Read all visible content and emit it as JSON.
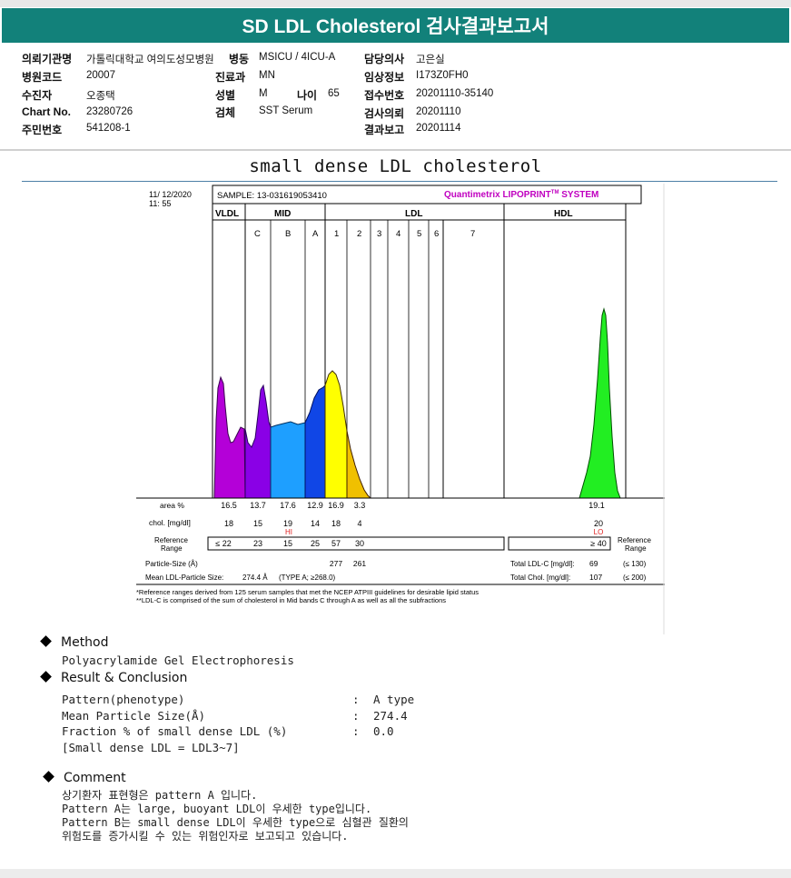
{
  "report": {
    "title": "SD LDL Cholesterol 검사결과보고서"
  },
  "info": {
    "hospital_label": "의뢰기관명",
    "hospital": "가톨릭대학교 여의도성모병원",
    "ward_label": "병동",
    "ward": "MSICU / 4ICU-A",
    "doctor_label": "담당의사",
    "doctor": "고은실",
    "code_label": "병원코드",
    "code": "20007",
    "dept_label": "진료과",
    "dept": "MN",
    "clinical_label": "임상정보",
    "clinical": "I173Z0FH0",
    "patient_label": "수진자",
    "patient": "오종택",
    "sex_label": "성별",
    "sex": "M",
    "age_label": "나이",
    "age": "65",
    "receipt_label": "접수번호",
    "receipt": "20201110-35140",
    "chart_label": "Chart No.",
    "chart": "23280726",
    "specimen_label": "검체",
    "specimen": "SST Serum",
    "request_label": "검사의뢰",
    "request": "20201110",
    "id_label": "주민번호",
    "id": "541208-1",
    "reported_label": "결과보고",
    "reported": "20201114"
  },
  "section_title": "small dense LDL cholesterol",
  "figure": {
    "date": "11/ 12/2020",
    "time": "11: 55",
    "sample": "SAMPLE:  13-031619053410",
    "brand": "Quantimetrix LIPOPRINT",
    "brand_tm": "TM",
    "brand_sys": " SYSTEM",
    "header_vldl": "VLDL",
    "header_mid": "MID",
    "header_ldl": "LDL",
    "header_hdl": "HDL",
    "bands": [
      "C",
      "B",
      "A",
      "1",
      "2",
      "3",
      "4",
      "5",
      "6",
      "7"
    ],
    "row_area_label": "area %",
    "row_chol_label": "chol. [mg/dl]",
    "row_ref_label1": "Reference",
    "row_ref_label2": "Range",
    "areas": [
      "16.5",
      "13.7",
      "17.6",
      "12.9",
      "16.9",
      "3.3",
      "19.1"
    ],
    "chols": [
      "18",
      "15",
      "19",
      "14",
      "18",
      "4",
      "20"
    ],
    "flag_hi": "HI",
    "flag_lo": "LO",
    "ref_left": [
      "≤ 22",
      "23",
      "15",
      "25",
      "57",
      "30"
    ],
    "ref_hdl": "≥ 40",
    "ref_right1": "Reference",
    "ref_right2": "Range",
    "particle_label": "Particle-Size (Å)",
    "particle_1": "277",
    "particle_2": "261",
    "mean_label": "Mean LDL-Particle Size:",
    "mean_value": "274.4 Å",
    "mean_type": "(TYPE A; ≥268.0)",
    "total_ldl_label": "Total LDL-C [mg/dl]:",
    "total_ldl": "69",
    "total_ldl_ref": "(≤ 130)",
    "total_chol_label": "Total Chol. [mg/dl]:",
    "total_chol": "107",
    "total_chol_ref": "(≤ 200)",
    "foot1": "*Reference ranges derived from 125 serum samples that met the NCEP ATPIII guidelines for desirable lipid status",
    "foot2": "**LDL-C is comprised of the sum of cholesterol in Mid bands C through A as well as all the subfractions",
    "colors": {
      "vldl": "#b400d8",
      "c": "#8a00e6",
      "b": "#1e9fff",
      "a": "#1046e6",
      "ldl1": "#ffff00",
      "ldl2": "#f0c000",
      "hdl": "#22ee22"
    }
  },
  "method": {
    "heading": "Method",
    "text": "Polyacrylamide Gel Electrophoresis"
  },
  "result": {
    "heading": "Result & Conclusion",
    "rows": [
      {
        "label": "Pattern(phenotype)",
        "colon": ":",
        "value": "A type"
      },
      {
        "label": "Mean Particle Size(Å)",
        "colon": ":",
        "value": "274.4"
      },
      {
        "label": "Fraction % of small dense LDL (%)",
        "colon": ":",
        "value": "0.0"
      }
    ],
    "note": "[Small dense LDL = LDL3~7]"
  },
  "comment": {
    "heading": "Comment",
    "lines": [
      "상기환자 표현형은 pattern A 입니다.",
      "Pattern A는 large, buoyant LDL이 우세한 type입니다.",
      "Pattern B는 small dense LDL이 우세한 type으로 심혈관 질환의",
      "위험도를 증가시킬 수 있는 위험인자로 보고되고 있습니다."
    ]
  }
}
